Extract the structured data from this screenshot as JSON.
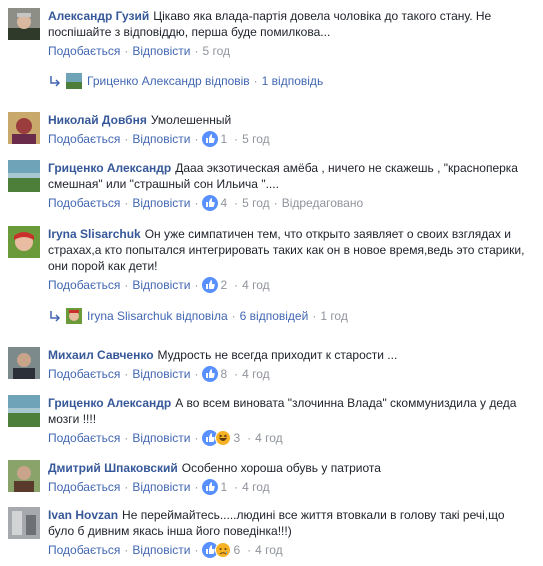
{
  "comments": [
    {
      "author": "Александр Гузий",
      "text": "Цікаво яка влада-партія довела чоловіка до такого стану. Не поспішайте з відповіддю, перша буде помилкова...",
      "like": "Подобається",
      "reply": "Відповісти",
      "reactions": "",
      "time": "5 год",
      "edited": ""
    },
    {
      "author": "Николай Довбня",
      "text": "Умолешенный",
      "like": "Подобається",
      "reply": "Відповісти",
      "reactions": "1",
      "time": "5 год",
      "edited": ""
    },
    {
      "author": "Гриценко Александр",
      "text": "Дааа экзотическая амёба , ничего не скажешь , \"красноперка смешная\" или \"страшный сон Ильича \"....",
      "like": "Подобається",
      "reply": "Відповісти",
      "reactions": "4",
      "time": "5 год",
      "edited": "Відредаговано"
    },
    {
      "author": "Iryna Slisarchuk",
      "text": "Он уже симпатичен тем, что открыто заявляет о своих взглядах и страхах,а кто попытался интегрировать таких как он в новое время,ведь это старики, они порой как дети!",
      "like": "Подобається",
      "reply": "Відповісти",
      "reactions": "2",
      "time": "4 год",
      "edited": ""
    },
    {
      "author": "Михаил Савченко",
      "text": "Мудрость не всегда приходит к старости ...",
      "like": "Подобається",
      "reply": "Відповісти",
      "reactions": "8",
      "time": "4 год",
      "edited": ""
    },
    {
      "author": "Гриценко Александр",
      "text": "А во всем виновата \"злочинна Влада\" скоммуниздила у деда мозги !!!!",
      "like": "Подобається",
      "reply": "Відповісти",
      "reactions": "3",
      "time": "4 год",
      "edited": ""
    },
    {
      "author": "Дмитрий Шпаковский",
      "text": "Особенно хороша обувь у патриота",
      "like": "Подобається",
      "reply": "Відповісти",
      "reactions": "1",
      "time": "4 год",
      "edited": ""
    },
    {
      "author": "Ivan Hovzan",
      "text": "Не переймайтесь.....людині все життя втовкали в голову такі речі,що було б дивним якась інша його поведінка!!!)",
      "like": "Подобається",
      "reply": "Відповісти",
      "reactions": "6",
      "time": "4 год",
      "edited": ""
    }
  ],
  "reply_threads": [
    {
      "name": "Гриценко Александр",
      "verb": "відповів",
      "count": "1 відповідь",
      "time": ""
    },
    {
      "name": "Iryna Slisarchuk",
      "verb": "відповіла",
      "count": "6 відповідей",
      "time": "1 год"
    }
  ],
  "colors": {
    "link": "#365899",
    "action": "#4267b2",
    "meta": "#90949c",
    "like_blue": "#5890ff",
    "haha_yellow": "#f7b125"
  }
}
